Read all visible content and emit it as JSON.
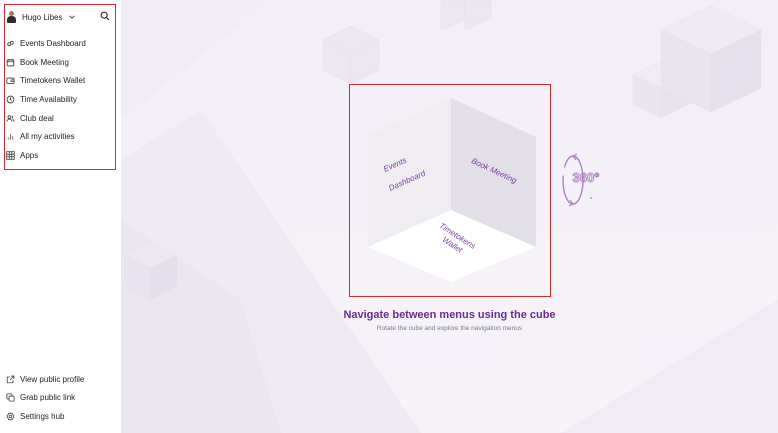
{
  "user": {
    "name": "Hugo Libes"
  },
  "nav": {
    "items": [
      {
        "label": "Events Dashboard",
        "icon": "link-icon"
      },
      {
        "label": "Book Meeting",
        "icon": "calendar-icon"
      },
      {
        "label": "Timetokens Wallet",
        "icon": "wallet-icon"
      },
      {
        "label": "Time Availability",
        "icon": "clock-icon"
      },
      {
        "label": "Club deal",
        "icon": "users-icon"
      },
      {
        "label": "All my activities",
        "icon": "bar-chart-icon"
      },
      {
        "label": "Apps",
        "icon": "grid-icon"
      }
    ]
  },
  "bottom_nav": {
    "items": [
      {
        "label": "View public profile",
        "icon": "external-link-icon"
      },
      {
        "label": "Grab public link",
        "icon": "copy-icon"
      },
      {
        "label": "Settings hub",
        "icon": "gear-icon"
      }
    ]
  },
  "cube": {
    "left_face": [
      "Events",
      "Dashboard"
    ],
    "right_face": [
      "Book Meeting"
    ],
    "bottom_face": [
      "Timetokens",
      "Wallet"
    ],
    "rotate_label": "360°"
  },
  "headline": "Navigate between menus using the cube",
  "subline": "Rotate the cube and explore the navigation menus",
  "colors": {
    "accent": "#6a2d8f",
    "frame": "#e0242b",
    "icon_purple": "#b07fc4"
  }
}
